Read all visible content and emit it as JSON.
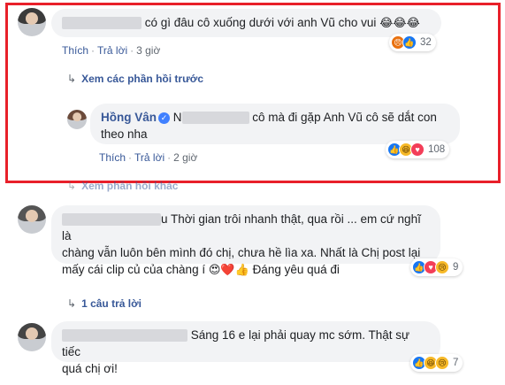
{
  "comment1": {
    "text": "có gì đâu cô xuống dưới với anh Vũ cho vui",
    "emoji": "😂😂😂",
    "actions": {
      "like": "Thích",
      "reply": "Trả lời",
      "time": "3 giờ"
    },
    "reactions": {
      "icons": [
        "angry-icon",
        "like-icon"
      ],
      "count": "32"
    }
  },
  "view_previous": "Xem các phần hồi trước",
  "reply1": {
    "author": "Hồng Vân",
    "prefix": "N",
    "text_line1": "cô mà đi gặp Anh Vũ cô sẽ dắt con",
    "text_line2": "theo nha",
    "actions": {
      "like": "Thích",
      "reply": "Trả lời",
      "time": "2 giờ"
    },
    "reactions": {
      "icons": [
        "like-icon",
        "haha-icon",
        "love-icon"
      ],
      "count": "108"
    }
  },
  "view_previous_2": "Xem phần hồi khác",
  "comment2": {
    "tail": "u",
    "line1": "Thời gian trôi nhanh thật, qua rồi ... em cứ nghĩ là",
    "line2": "chàng vẫn luôn bên mình đó chị, chưa hề lìa xa. Nhất là Chị post lại",
    "line3_pre": "mấy cái clip củ của chàng í",
    "line3_emoji": "😍❤️👍",
    "line3_post": "Đáng yêu quá đi",
    "reactions": {
      "icons": [
        "like-icon",
        "love-icon",
        "sad-icon"
      ],
      "count": "9"
    },
    "replies": "1 câu trả lời"
  },
  "comment3": {
    "line1": "Sáng 16 e lại phải quay mc sớm. Thật sự tiếc",
    "line2": "quá chị ơi!",
    "reactions": {
      "icons": [
        "like-icon",
        "haha-icon",
        "sad-icon"
      ],
      "count": "7"
    }
  }
}
